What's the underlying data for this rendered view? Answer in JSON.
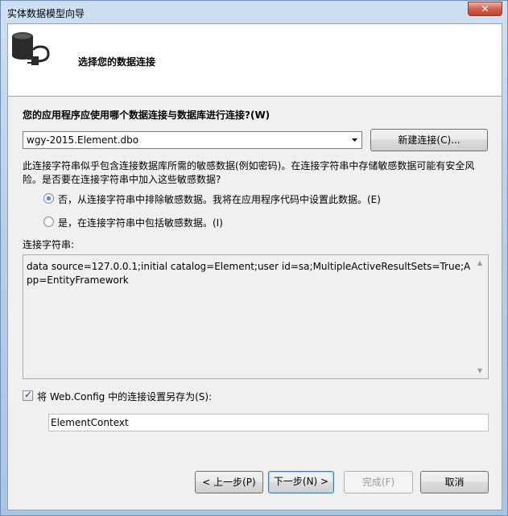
{
  "window": {
    "title": "实体数据模型向导",
    "close_label": "✕"
  },
  "header": {
    "title": "选择您的数据连接",
    "icon": "database-plug-icon"
  },
  "question": "您的应用程序应使用哪个数据连接与数据库进行连接?(W)",
  "connection": {
    "selected": "wgy-2015.Element.dbo",
    "new_button": "新建连接(C)..."
  },
  "warning": "此连接字符串似乎包含连接数据库所需的敏感数据(例如密码)。在连接字符串中存储敏感数据可能有安全风险。是否要在连接字符串中加入这些敏感数据?",
  "options": [
    {
      "label": "否，从连接字符串中排除敏感数据。我将在应用程序代码中设置此数据。(E)",
      "checked": true
    },
    {
      "label": "是，在连接字符串中包括敏感数据。(I)",
      "checked": false
    }
  ],
  "connection_string": {
    "label": "连接字符串:",
    "value": "data source=127.0.0.1;initial catalog=Element;user id=sa;MultipleActiveResultSets=True;App=EntityFramework"
  },
  "save_config": {
    "label": "将 Web.Config 中的连接设置另存为(S):",
    "checked": true,
    "value": "ElementContext"
  },
  "footer": {
    "back": "< 上一步(P)",
    "next": "下一步(N) >",
    "finish": "完成(F)",
    "cancel": "取消"
  }
}
